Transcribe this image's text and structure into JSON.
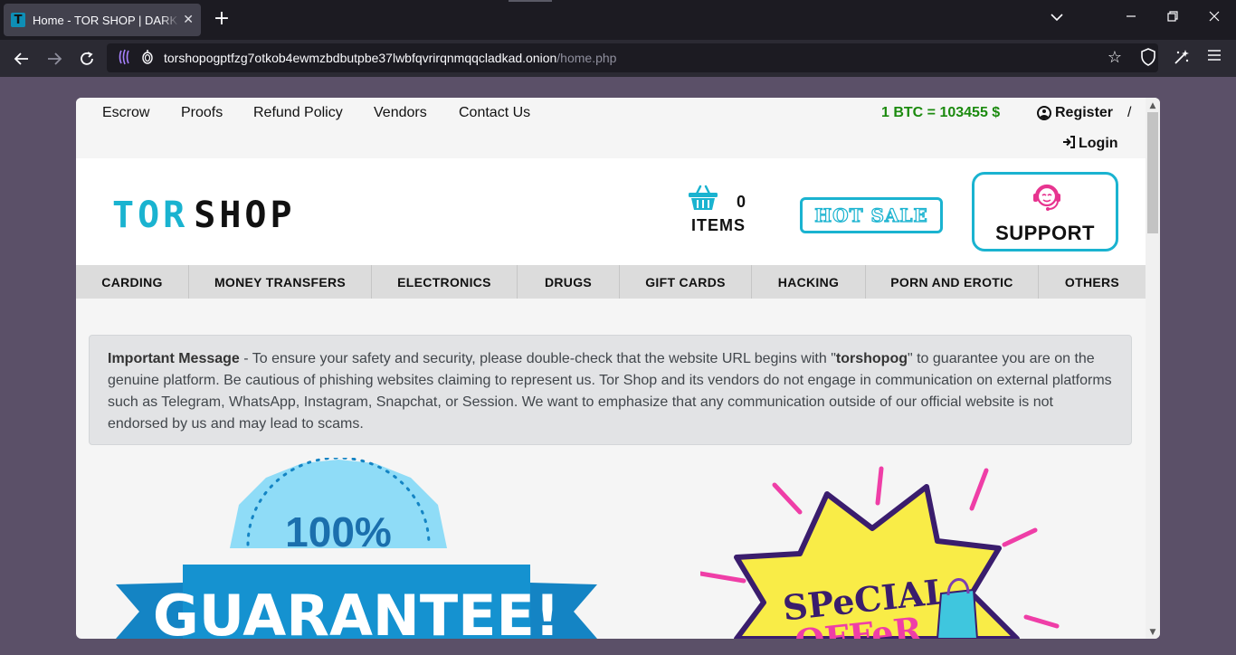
{
  "browser": {
    "tab_title": "Home - TOR SHOP | DARK WEB",
    "favicon_letter": "T",
    "url_host": "torshopogptfzg7otkob4ewmzbdbutpbe37lwbfqvrirqnmqqcladkad.onion",
    "url_path": "/home.php"
  },
  "topnav": {
    "links": [
      "Escrow",
      "Proofs",
      "Refund Policy",
      "Vendors",
      "Contact Us"
    ],
    "btc_rate": "1 BTC = 103455 $",
    "register": "Register",
    "separator": "/",
    "login": "Login"
  },
  "header": {
    "logo_tor": "TOR",
    "logo_shop": "SHOP",
    "cart_count": "0",
    "cart_label": "ITEMS",
    "hot_sale": "HOT SALE",
    "support": "SUPPORT"
  },
  "categories": [
    "CARDING",
    "MONEY TRANSFERS",
    "ELECTRONICS",
    "DRUGS",
    "GIFT CARDS",
    "HACKING",
    "PORN AND EROTIC",
    "OTHERS"
  ],
  "alert": {
    "title": "Important Message",
    "part1": " - To ensure your safety and security, please double-check that the website URL begins with \"",
    "keyword": "torshopog",
    "part2": "\" to guarantee you are on the genuine platform. Be cautious of phishing websites claiming to represent us. Tor Shop and its vendors do not engage in communication on external platforms such as Telegram, WhatsApp, Instagram, Snapchat, or Session. We want to emphasize that any communication outside of our official website is not endorsed by us and may lead to scams."
  },
  "banners": {
    "guarantee_percent": "100%",
    "guarantee_word": "GUARANTEE!",
    "special": "SPeCIAL",
    "offer": "OFFeR"
  },
  "colors": {
    "accent": "#1ab3d0",
    "btc": "#1b8a0e",
    "support_icon": "#e7338f"
  }
}
